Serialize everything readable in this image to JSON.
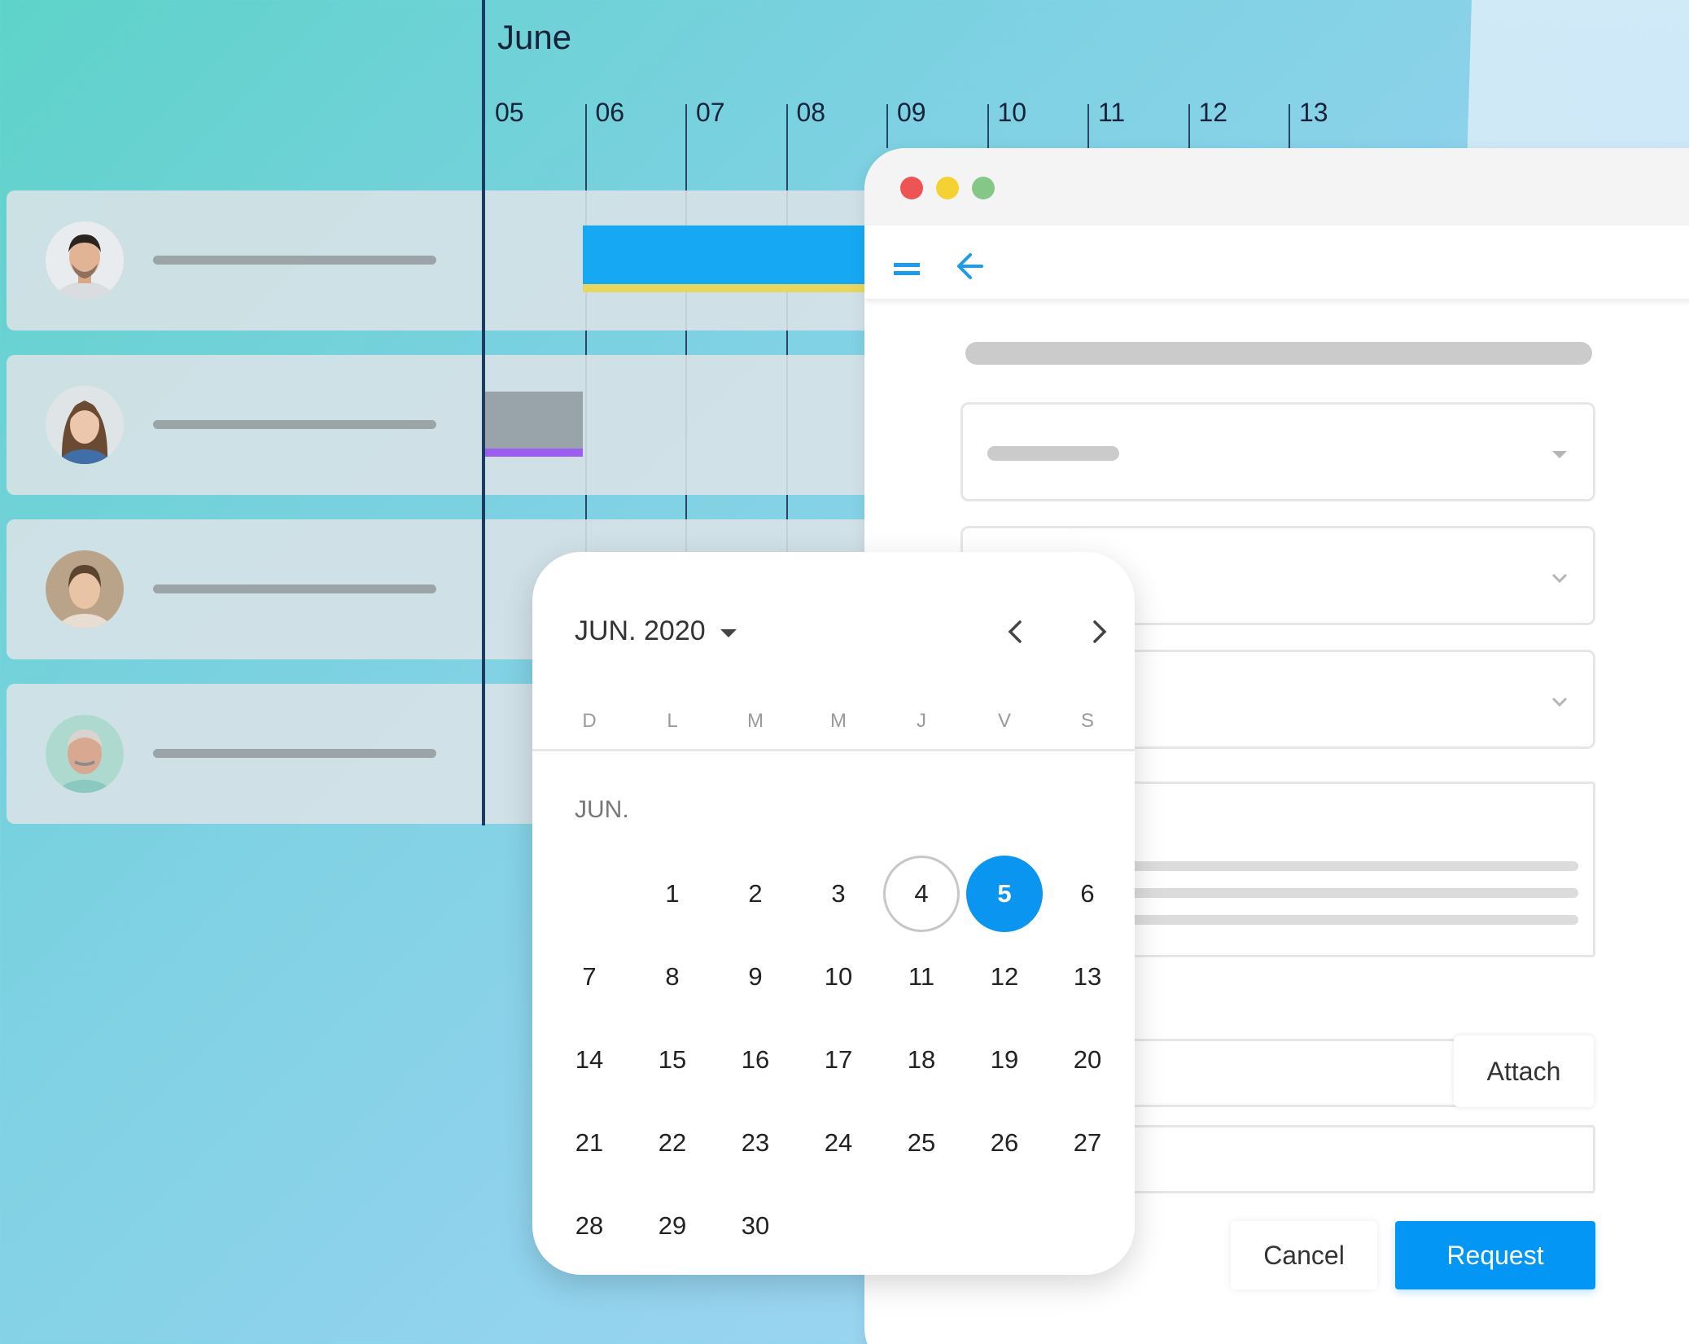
{
  "gantt": {
    "month": "June",
    "days": [
      "05",
      "06",
      "07",
      "08",
      "09",
      "10",
      "11",
      "12",
      "13"
    ],
    "rows": [
      {
        "avatar": "person-young-man"
      },
      {
        "avatar": "person-woman-long-hair"
      },
      {
        "avatar": "person-woman-smiling"
      },
      {
        "avatar": "person-older-man"
      }
    ],
    "colors": {
      "blue_bar": "#17a8f4",
      "yellow_line": "#e7d761",
      "grey_bar": "#98a4aa",
      "purple_line": "#9b5ef0"
    }
  },
  "window": {
    "controls": [
      "#ee5454",
      "#f5d234",
      "#85c786"
    ],
    "toolbar_icons": [
      "menu-icon",
      "back-arrow-icon"
    ],
    "attach_label": "Attach",
    "cancel_label": "Cancel",
    "request_label": "Request",
    "accent": "#0496f4"
  },
  "calendar": {
    "title": "JUN. 2020",
    "weekdays": [
      "D",
      "L",
      "M",
      "M",
      "J",
      "V",
      "S"
    ],
    "month_label": "JUN.",
    "days": [
      "1",
      "2",
      "3",
      "4",
      "5",
      "6",
      "7",
      "8",
      "9",
      "10",
      "11",
      "12",
      "13",
      "14",
      "15",
      "16",
      "17",
      "18",
      "19",
      "20",
      "21",
      "22",
      "23",
      "24",
      "25",
      "26",
      "27",
      "28",
      "29",
      "30"
    ],
    "first_weekday_index": 1,
    "today": "4",
    "selected": "5"
  }
}
